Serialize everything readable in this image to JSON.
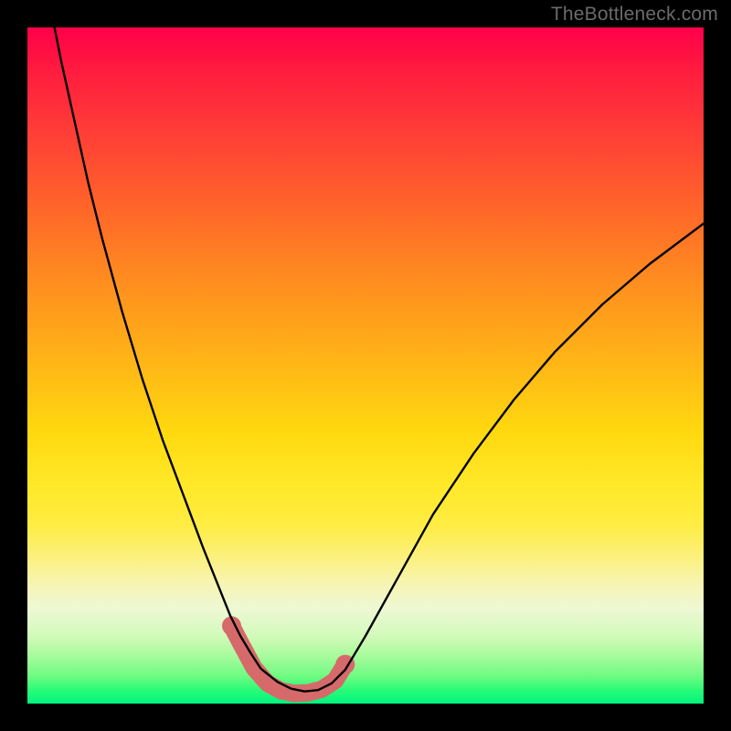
{
  "watermark": "TheBottleneck.com",
  "chart_data": {
    "type": "line",
    "title": "",
    "xlabel": "",
    "ylabel": "",
    "xlim": [
      0,
      100
    ],
    "ylim": [
      0,
      100
    ],
    "grid": false,
    "legend": false,
    "curve": {
      "x": [
        4,
        5,
        7,
        9,
        11,
        14,
        17,
        20,
        23,
        26,
        28,
        30,
        31.5,
        33,
        34.5,
        35.6,
        37,
        39,
        41,
        43,
        45,
        47,
        50,
        55,
        60,
        66,
        72,
        78,
        85,
        92,
        100
      ],
      "y": [
        100,
        95,
        86,
        77,
        69,
        58,
        48,
        39,
        31,
        23,
        18,
        13,
        10,
        7.5,
        5.2,
        4.3,
        3.2,
        2.2,
        1.8,
        2.0,
        3.0,
        5.0,
        10,
        19,
        28,
        37,
        45,
        52,
        59,
        65,
        71
      ]
    },
    "highlight_band": {
      "x": [
        30.2,
        31.5,
        33.5,
        35.5,
        37.5,
        39.5,
        41.5,
        43.5,
        45.5,
        47.0
      ],
      "y": [
        11.5,
        9.0,
        5.3,
        3.0,
        1.9,
        1.5,
        1.6,
        2.1,
        3.4,
        5.8
      ],
      "color": "#d66a6a",
      "dot_x": [
        30.2,
        47.0
      ],
      "dot_y": [
        11.5,
        5.8
      ]
    }
  }
}
